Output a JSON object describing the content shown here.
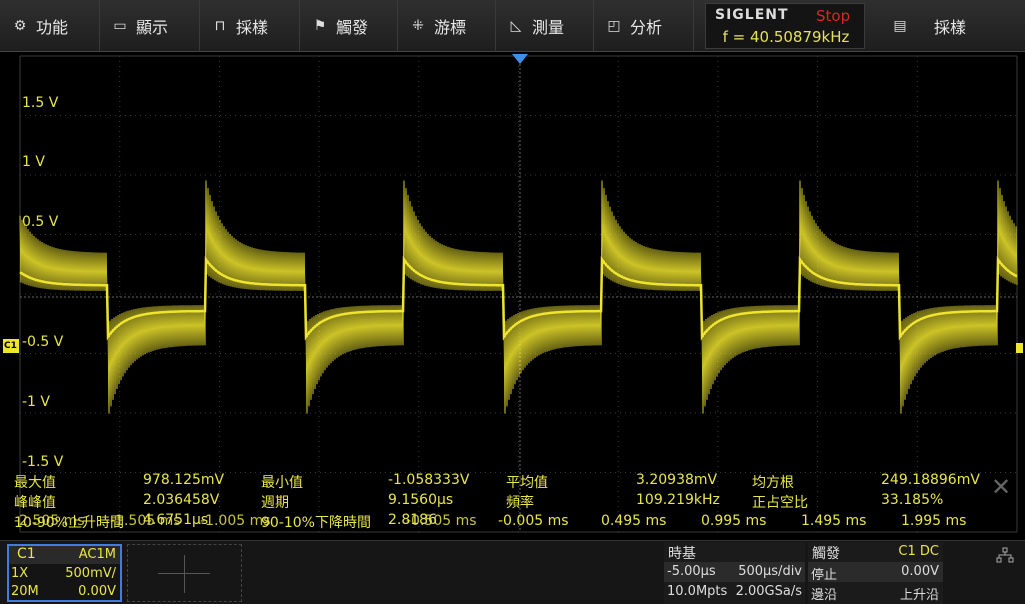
{
  "menu": {
    "items": [
      {
        "label": "功能",
        "icon": "gear-icon"
      },
      {
        "label": "顯示",
        "icon": "display-icon"
      },
      {
        "label": "採樣",
        "icon": "waveform-icon"
      },
      {
        "label": "觸發",
        "icon": "flag-icon"
      },
      {
        "label": "游標",
        "icon": "cursor-icon"
      },
      {
        "label": "測量",
        "icon": "ruler-icon"
      },
      {
        "label": "分析",
        "icon": "analysis-icon"
      }
    ],
    "brand": "SIGLENT",
    "run_status": "Stop",
    "frequency": "f = 40.50879kHz",
    "acquire_label": "採樣",
    "acquire_icon": "list-icon"
  },
  "plot": {
    "voltage_labels": [
      "1.5 V",
      "1 V",
      "0.5 V",
      "-0.5 V",
      "-1 V",
      "-1.5 V"
    ],
    "channel_marker": "C1",
    "trace_color": "#f0e52e",
    "grid_color": "#3a3a3a"
  },
  "measurements": {
    "row1": [
      {
        "name": "最大值",
        "value": "978.125mV"
      },
      {
        "name": "最小值",
        "value": "-1.058333V"
      },
      {
        "name": "平均值",
        "value": "3.20938mV"
      },
      {
        "name": "均方根",
        "value": "249.18896mV"
      }
    ],
    "row2": [
      {
        "name": "峰峰值",
        "value": "2.036458V"
      },
      {
        "name": "週期",
        "value": "9.1560μs"
      },
      {
        "name": "頻率",
        "value": "109.219kHz"
      },
      {
        "name": "正占空比",
        "value": "33.185%"
      }
    ],
    "row3_overlay": {
      "rise_label": "10-90%上升時間",
      "rise_value": "4.6751μs",
      "fall_label": "90-10%下降時間",
      "fall_value": "2.8186",
      "time_ticks": [
        "-2.505 ms",
        "-1.505 ms",
        "-1.005 ms",
        "-0.505 ms",
        "-0.005 ms",
        "0.495 ms",
        "0.995 ms",
        "1.495 ms",
        "1.995 ms"
      ]
    }
  },
  "channel1": {
    "name": "C1",
    "coupling": "AC1M",
    "probe": "1X",
    "scale": "500mV/",
    "bandwidth": "20M",
    "offset": "0.00V"
  },
  "timebase": {
    "title": "時基",
    "delay": "-5.00μs",
    "scale": "500μs/div",
    "memory": "10.0Mpts",
    "sample_rate": "2.00GSa/s"
  },
  "trigger": {
    "title": "觸發",
    "source": "C1 DC",
    "mode": "停止",
    "level": "0.00V",
    "type": "邊沿",
    "slope": "上升沿"
  }
}
